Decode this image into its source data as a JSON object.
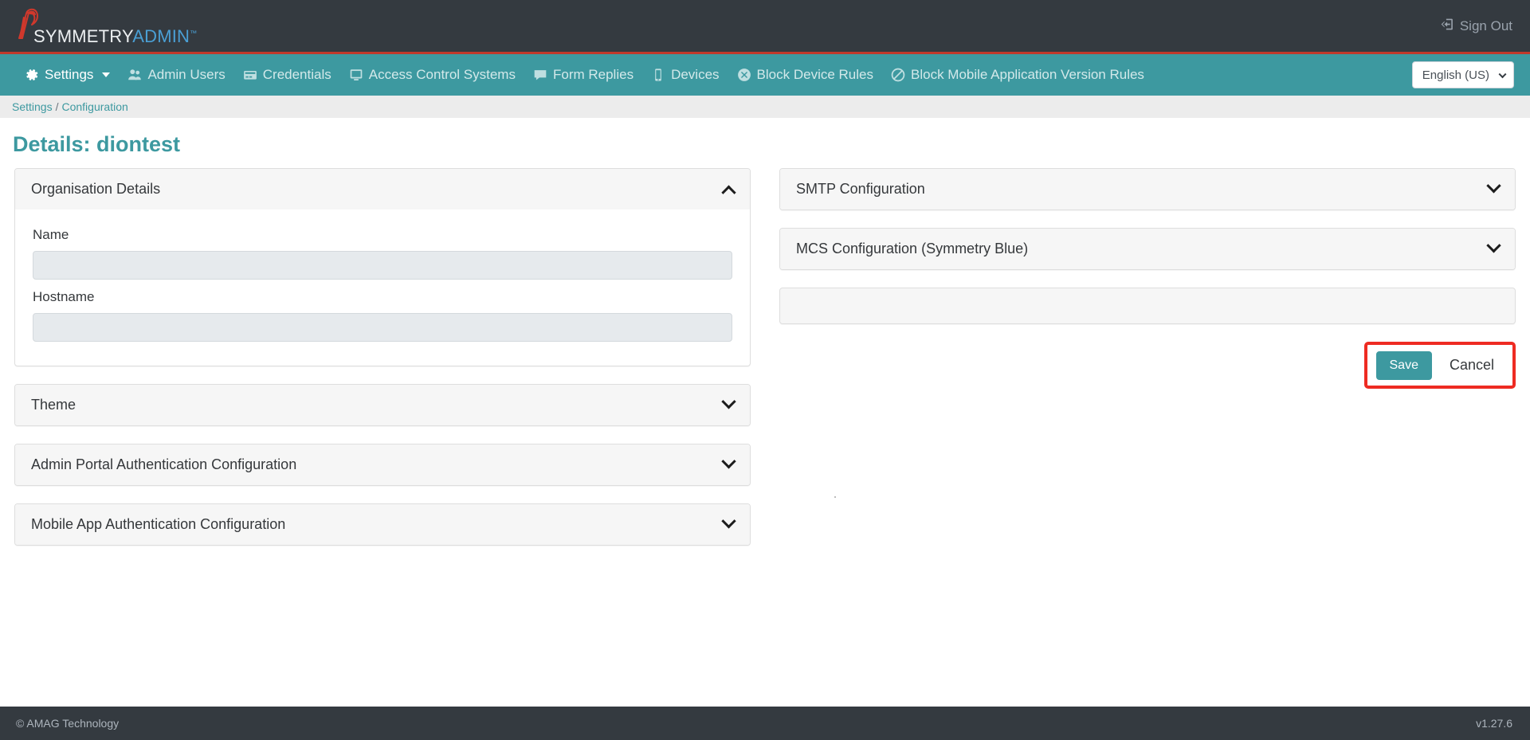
{
  "header": {
    "logo": {
      "part1": "SYMMETRY",
      "part2": "ADMIN",
      "tm": "™",
      "icon": "eagle-logo-icon"
    },
    "signout": {
      "label": "Sign Out",
      "icon": "sign-out-icon"
    }
  },
  "nav": {
    "items": [
      {
        "label": "Settings",
        "icon": "gear-icon",
        "active": true,
        "caret": true
      },
      {
        "label": "Admin Users",
        "icon": "users-icon",
        "active": false
      },
      {
        "label": "Credentials",
        "icon": "card-icon",
        "active": false
      },
      {
        "label": "Access Control Systems",
        "icon": "monitor-icon",
        "active": false
      },
      {
        "label": "Form Replies",
        "icon": "comment-icon",
        "active": false
      },
      {
        "label": "Devices",
        "icon": "mobile-icon",
        "active": false
      },
      {
        "label": "Block Device Rules",
        "icon": "times-circle-icon",
        "active": false
      },
      {
        "label": "Block Mobile Application Version Rules",
        "icon": "ban-icon",
        "active": false
      }
    ],
    "language": {
      "selected": "English (US)",
      "icon": "chevron-down-icon"
    }
  },
  "breadcrumb": {
    "root": "Settings",
    "separator": "/",
    "current": "Configuration"
  },
  "page": {
    "title": "Details: diontest"
  },
  "left_column": {
    "organisation_details": {
      "title": "Organisation Details",
      "expanded": true,
      "chevron": "chevron-up-icon",
      "fields": [
        {
          "label": "Name",
          "value": "",
          "placeholder": ""
        },
        {
          "label": "Hostname",
          "value": "",
          "placeholder": ""
        }
      ]
    },
    "panels": [
      {
        "title": "Theme",
        "chevron": "chevron-down-icon"
      },
      {
        "title": "Admin Portal Authentication Configuration",
        "chevron": "chevron-down-icon"
      },
      {
        "title": "Mobile App Authentication Configuration",
        "chevron": "chevron-down-icon"
      }
    ]
  },
  "right_column": {
    "panels": [
      {
        "title": "SMTP Configuration",
        "chevron": "chevron-down-icon"
      },
      {
        "title": "MCS Configuration (Symmetry Blue)",
        "chevron": "chevron-down-icon"
      }
    ],
    "blank_panel": true
  },
  "actions": {
    "save_label": "Save",
    "cancel_label": "Cancel",
    "highlight_color": "#ee2b22",
    "save_color": "#3d99a0"
  },
  "footer": {
    "copyright": "© AMAG Technology",
    "version": "v1.27.6"
  },
  "colors": {
    "brand_teal": "#3d99a0",
    "dark": "#343a40",
    "accent_red": "#c0392b",
    "logo_blue": "#4a9fd4"
  }
}
